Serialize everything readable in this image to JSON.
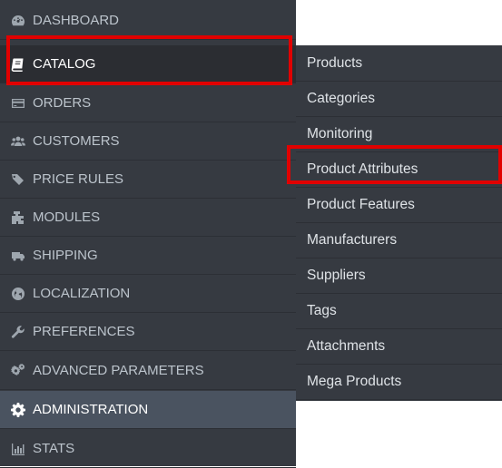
{
  "sidebar": {
    "items": [
      {
        "label": "DASHBOARD",
        "icon": "dashboard-icon"
      },
      {
        "label": "CATALOG",
        "icon": "book-icon"
      },
      {
        "label": "ORDERS",
        "icon": "credit-card-icon"
      },
      {
        "label": "CUSTOMERS",
        "icon": "users-icon"
      },
      {
        "label": "PRICE RULES",
        "icon": "tag-icon"
      },
      {
        "label": "MODULES",
        "icon": "puzzle-icon"
      },
      {
        "label": "SHIPPING",
        "icon": "truck-icon"
      },
      {
        "label": "LOCALIZATION",
        "icon": "globe-icon"
      },
      {
        "label": "PREFERENCES",
        "icon": "wrench-icon"
      },
      {
        "label": "ADVANCED PARAMETERS",
        "icon": "cogs-icon"
      },
      {
        "label": "ADMINISTRATION",
        "icon": "gear-icon"
      },
      {
        "label": "STATS",
        "icon": "bar-chart-icon"
      }
    ],
    "active_item": "CATALOG",
    "selected_item": "ADMINISTRATION"
  },
  "submenu": {
    "items": [
      "Products",
      "Categories",
      "Monitoring",
      "Product Attributes",
      "Product Features",
      "Manufacturers",
      "Suppliers",
      "Tags",
      "Attachments",
      "Mega Products"
    ],
    "highlighted_item": "Product Attributes"
  },
  "colors": {
    "sidebar_bg": "#363a41",
    "highlight": "#e10000",
    "active_bg": "#2b2d32",
    "selected_bg": "#4a5360"
  }
}
